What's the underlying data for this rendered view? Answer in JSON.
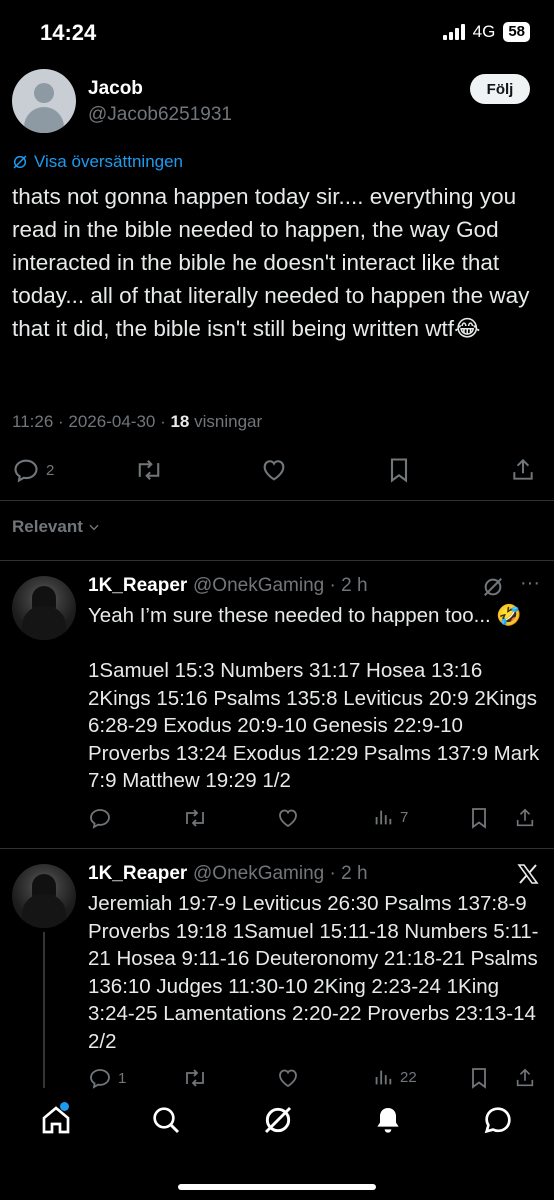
{
  "status_bar": {
    "time": "14:24",
    "network": "4G",
    "battery": "58"
  },
  "post": {
    "author_name": "Jacob",
    "author_handle": "@Jacob6251931",
    "follow_label": "Följ",
    "translate_label": "Visa översättningen",
    "text": "thats not gonna happen today sir.... everything you read in the bible needed to happen, the way God interacted in the bible he doesn't interact like that today... all of that literally needed to happen the way that it did, the bible isn't still being written wtf😂",
    "time": "11:26",
    "date": "2026-04-30",
    "views_count": "18",
    "views_label": "visningar",
    "reply_count": "2",
    "icons": [
      "reply-icon",
      "retweet-icon",
      "like-icon",
      "bookmark-icon",
      "share-icon"
    ]
  },
  "sort": {
    "label": "Relevant"
  },
  "replies": [
    {
      "author_name": "1K_Reaper",
      "author_handle": "@OnekGaming",
      "age": "2 h",
      "text": "Yeah I’m sure these needed to happen too... 🤣\n\n1Samuel 15:3  Numbers 31:17  Hosea 13:16  2Kings 15:16  Psalms 135:8  Leviticus 20:9  2Kings 6:28-29  Exodus 20:9-10  Genesis 22:9-10  Proverbs 13:24  Exodus 12:29  Psalms 137:9  Mark 7:9  Matthew 19:29  1/2",
      "reply_count": "",
      "views_count": "7"
    },
    {
      "author_name": "1K_Reaper",
      "author_handle": "@OnekGaming",
      "age": "2 h",
      "text": "Jeremiah 19:7-9  Leviticus 26:30  Psalms 137:8-9  Proverbs 19:18  1Samuel 15:11-18  Numbers 5:11-21  Hosea 9:11-16  Deuteronomy 21:18-21  Psalms 136:10  Judges 11:30-10  2King 2:23-24  1King 3:24-25  Lamentations 2:20-22  Proverbs 23:13-14 2/2",
      "reply_count": "1",
      "views_count": "22"
    }
  ],
  "bottom_nav": [
    "home-icon",
    "search-icon",
    "grok-icon",
    "notifications-icon",
    "messages-icon"
  ],
  "colors": {
    "background": "#000000",
    "text": "#e7e9ea",
    "muted": "#71767b",
    "accent": "#1d9bf0",
    "divider": "#2f3336"
  }
}
